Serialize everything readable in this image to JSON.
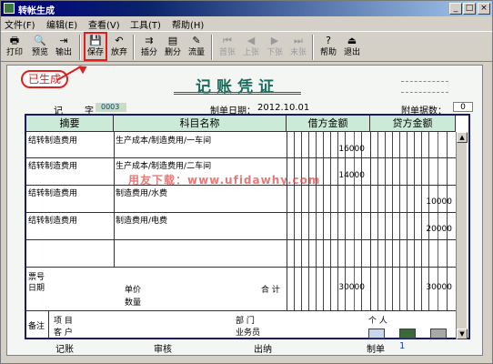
{
  "window": {
    "title": "转帐生成",
    "controls": [
      "_",
      "□",
      "×"
    ]
  },
  "menus": [
    "文件(F)",
    "编辑(E)",
    "查看(V)",
    "工具(T)",
    "帮助(H)"
  ],
  "toolbar": {
    "buttons": [
      {
        "label": "打印",
        "icon": "printer-icon",
        "glyph": "🖶"
      },
      {
        "label": "预览",
        "icon": "preview-icon",
        "glyph": "🔍"
      },
      {
        "label": "输出",
        "icon": "export-icon",
        "glyph": "⇥"
      },
      {
        "label": "保存",
        "icon": "save-icon",
        "glyph": "💾"
      },
      {
        "label": "放弃",
        "icon": "undo-icon",
        "glyph": "↶"
      },
      {
        "label": "插分",
        "icon": "insert-row-icon",
        "glyph": "⇉"
      },
      {
        "label": "删分",
        "icon": "delete-row-icon",
        "glyph": "▤"
      },
      {
        "label": "流量",
        "icon": "cashflow-icon",
        "glyph": "✎"
      },
      {
        "label": "首张",
        "icon": "first-icon",
        "glyph": "⏮",
        "disabled": true
      },
      {
        "label": "上张",
        "icon": "prev-icon",
        "glyph": "◀",
        "disabled": true
      },
      {
        "label": "下张",
        "icon": "next-icon",
        "glyph": "▶",
        "disabled": true
      },
      {
        "label": "末张",
        "icon": "last-icon",
        "glyph": "⏭",
        "disabled": true
      },
      {
        "label": "帮助",
        "icon": "help-icon",
        "glyph": "?"
      },
      {
        "label": "退出",
        "icon": "exit-icon",
        "glyph": "⏏"
      }
    ]
  },
  "voucher": {
    "status_badge": "已生成",
    "title": "记账凭证",
    "type_label": "记",
    "zi_label": "字",
    "number": "0003",
    "date_label": "制单日期：",
    "date": "2012.10.01",
    "attachments_label": "附单据数：",
    "attachments": "0",
    "columns": {
      "summary": "摘要",
      "account": "科目名称",
      "debit": "借方金额",
      "credit": "贷方金额"
    },
    "rows": [
      {
        "summary": "结转制造费用",
        "account": "生产成本/制造费用/一车间",
        "debit": "16000",
        "credit": ""
      },
      {
        "summary": "结转制造费用",
        "account": "生产成本/制造费用/二车间",
        "debit": "14000",
        "credit": ""
      },
      {
        "summary": "结转制造费用",
        "account": "制造费用/水费",
        "debit": "",
        "credit": "10000"
      },
      {
        "summary": "结转制造费用",
        "account": "制造费用/电费",
        "debit": "",
        "credit": "20000"
      }
    ],
    "bottom": {
      "ticket_no_label": "票号",
      "date_label": "日期",
      "unit_price_label": "单价",
      "quantity_label": "数量",
      "total_label": "合 计",
      "total_debit": "30000",
      "total_credit": "30000",
      "remark_label": "备注",
      "project_label": "项 目",
      "customer_label": "客 户",
      "dept_label": "部 门",
      "salesperson_label": "业务员",
      "person_label": "个 人"
    },
    "footer": {
      "bookkeeper_label": "记账",
      "reviewer_label": "审核",
      "cashier_label": "出纳",
      "maker_label": "制单",
      "maker_value": "1"
    },
    "watermark": "用友下载：www.ufidawhy.com"
  }
}
